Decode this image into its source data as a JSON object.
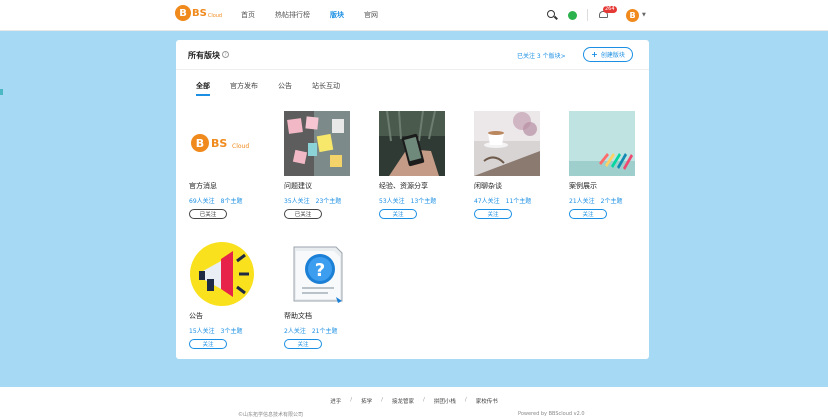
{
  "header": {
    "logo_letter": "B",
    "logo_bs": "BS",
    "logo_cloud": "Cloud",
    "nav": [
      "首页",
      "热帖排行榜",
      "版块",
      "官网"
    ],
    "active_nav": 2,
    "notification_count": "264",
    "avatar_letter": "B"
  },
  "panel": {
    "title": "所有版块",
    "help_glyph": "?",
    "follow_summary": "已关注 3 个版块>",
    "create_label": "创建版块",
    "tabs": [
      "全部",
      "官方发布",
      "公告",
      "站长互动"
    ],
    "active_tab": 0
  },
  "boards": [
    {
      "name": "官方消息",
      "followers": "69人关注",
      "topics": "8个主题",
      "button": "已关注",
      "followed": true
    },
    {
      "name": "问题建议",
      "followers": "35人关注",
      "topics": "23个主题",
      "button": "已关注",
      "followed": true
    },
    {
      "name": "经验、资源分享",
      "followers": "53人关注",
      "topics": "13个主题",
      "button": "关注",
      "followed": false
    },
    {
      "name": "闲聊杂谈",
      "followers": "47人关注",
      "topics": "11个主题",
      "button": "关注",
      "followed": false
    },
    {
      "name": "案例展示",
      "followers": "21人关注",
      "topics": "2个主题",
      "button": "关注",
      "followed": false
    },
    {
      "name": "公告",
      "followers": "15人关注",
      "topics": "3个主题",
      "button": "关注",
      "followed": false
    },
    {
      "name": "帮助文档",
      "followers": "2人关注",
      "topics": "21个主题",
      "button": "关注",
      "followed": false
    }
  ],
  "footer": {
    "links": [
      "进乎",
      "拓学",
      "接龙管家",
      "拼团小栈",
      "家校传书"
    ],
    "copyright": "©山东拓学信息技术有限公司",
    "powered": "Powered by BBScloud v2.0"
  },
  "colors": {
    "accent": "#1a8fe3",
    "brand": "#f08a1c",
    "page_bg": "#a6d9f3"
  }
}
